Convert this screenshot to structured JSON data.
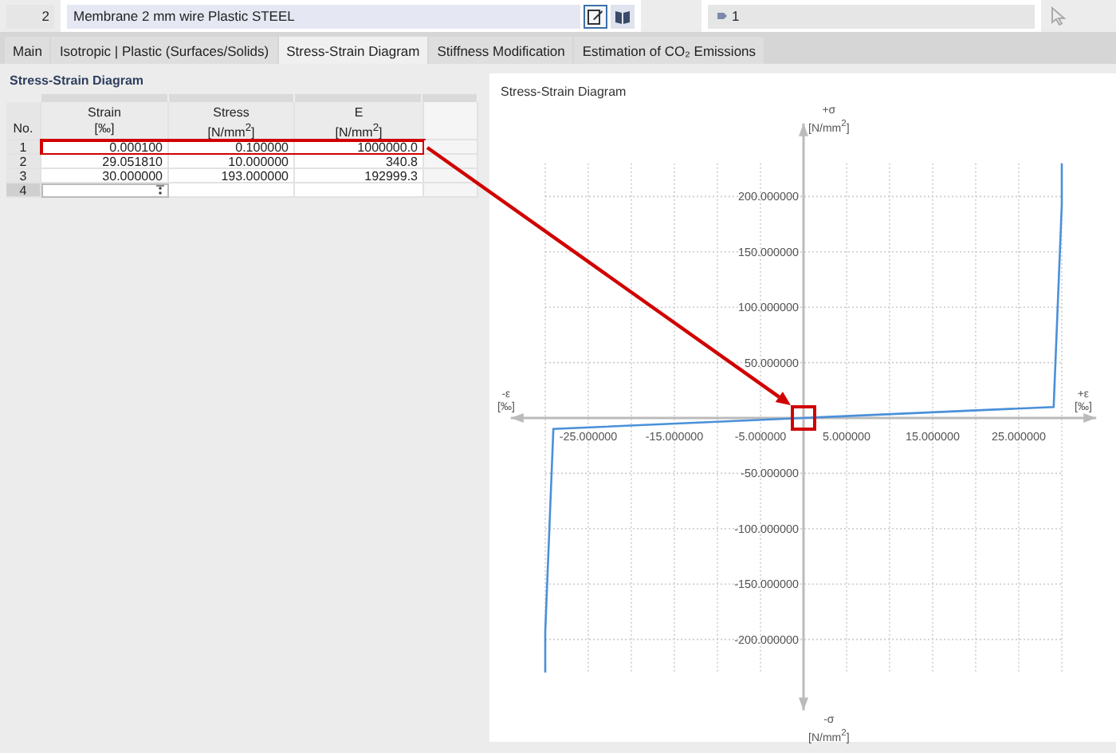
{
  "header": {
    "number": "2",
    "name": "Membrane 2 mm wire Plastic STEEL",
    "buttons": [
      {
        "kind": "edit",
        "selected": true
      },
      {
        "kind": "book",
        "selected": false
      }
    ],
    "assignment": "1"
  },
  "tabs": [
    {
      "label": "Main",
      "selected": false
    },
    {
      "label": "Isotropic | Plastic (Surfaces/Solids)",
      "selected": false
    },
    {
      "label": "Stress-Strain Diagram",
      "selected": true
    },
    {
      "label": "Stiffness Modification",
      "selected": false
    },
    {
      "label": "Estimation of CO₂ Emissions",
      "selected": false
    }
  ],
  "table": {
    "title": "Stress-Strain Diagram",
    "columns": [
      {
        "label": "No."
      },
      {
        "label": "Strain",
        "unit": "[‰]"
      },
      {
        "label": "Stress",
        "unit": "[N/mm$^{2}$]"
      },
      {
        "label": "E",
        "unit": "[N/mm$^{2}$]"
      }
    ],
    "rows": [
      {
        "no": "1",
        "strain": "0.000100",
        "stress": "0.100000",
        "e": "1000000.0",
        "highlighted": true,
        "selected": false,
        "editing": false
      },
      {
        "no": "2",
        "strain": "29.051810",
        "stress": "10.000000",
        "e": "340.8",
        "highlighted": false,
        "selected": false,
        "editing": false
      },
      {
        "no": "3",
        "strain": "30.000000",
        "stress": "193.000000",
        "e": "192999.3",
        "highlighted": false,
        "selected": false,
        "editing": false
      },
      {
        "no": "4",
        "highlighted": false,
        "selected": true,
        "editing": true
      }
    ]
  },
  "chart": {
    "title": "Stress-Strain Diagram",
    "axis_labels": {
      "y_positive": {
        "symbol": "+σ",
        "unit": "[N/mm$^{2}$]"
      },
      "y_negative": {
        "symbol": "-σ",
        "unit": "[N/mm$^{2}$]"
      },
      "x_negative": {
        "symbol": "-ε",
        "unit": "[‰]"
      },
      "x_positive": {
        "symbol": "+ε",
        "unit": "[‰]"
      }
    },
    "origin_marker": {
      "color": "#d00000"
    },
    "chart_data": {
      "type": "line",
      "xlim": [
        -34,
        34
      ],
      "ylim": [
        -264,
        266
      ],
      "grid": true,
      "xticks": [
        {
          "value": -25,
          "label": "-25.000000"
        },
        {
          "value": -15,
          "label": "-15.000000"
        },
        {
          "value": -5,
          "label": "-5.000000"
        },
        {
          "value": 5,
          "label": "5.000000"
        },
        {
          "value": 15,
          "label": "15.000000"
        },
        {
          "value": 25,
          "label": "25.000000"
        }
      ],
      "yticks": [
        {
          "value": -200,
          "label": "-200.000000"
        },
        {
          "value": -150,
          "label": "-150.000000"
        },
        {
          "value": -100,
          "label": "-100.000000"
        },
        {
          "value": -50,
          "label": "-50.000000"
        },
        {
          "value": 50,
          "label": "50.000000"
        },
        {
          "value": 100,
          "label": "100.000000"
        },
        {
          "value": 150,
          "label": "150.000000"
        },
        {
          "value": 200,
          "label": "200.000000"
        }
      ],
      "x": [
        -30,
        -30,
        -29.05181,
        0,
        29.05181,
        30,
        30
      ],
      "series": [
        {
          "color": "#4a90d9",
          "values": [
            -230,
            -193,
            -10,
            0,
            10,
            193,
            230
          ]
        }
      ]
    }
  }
}
